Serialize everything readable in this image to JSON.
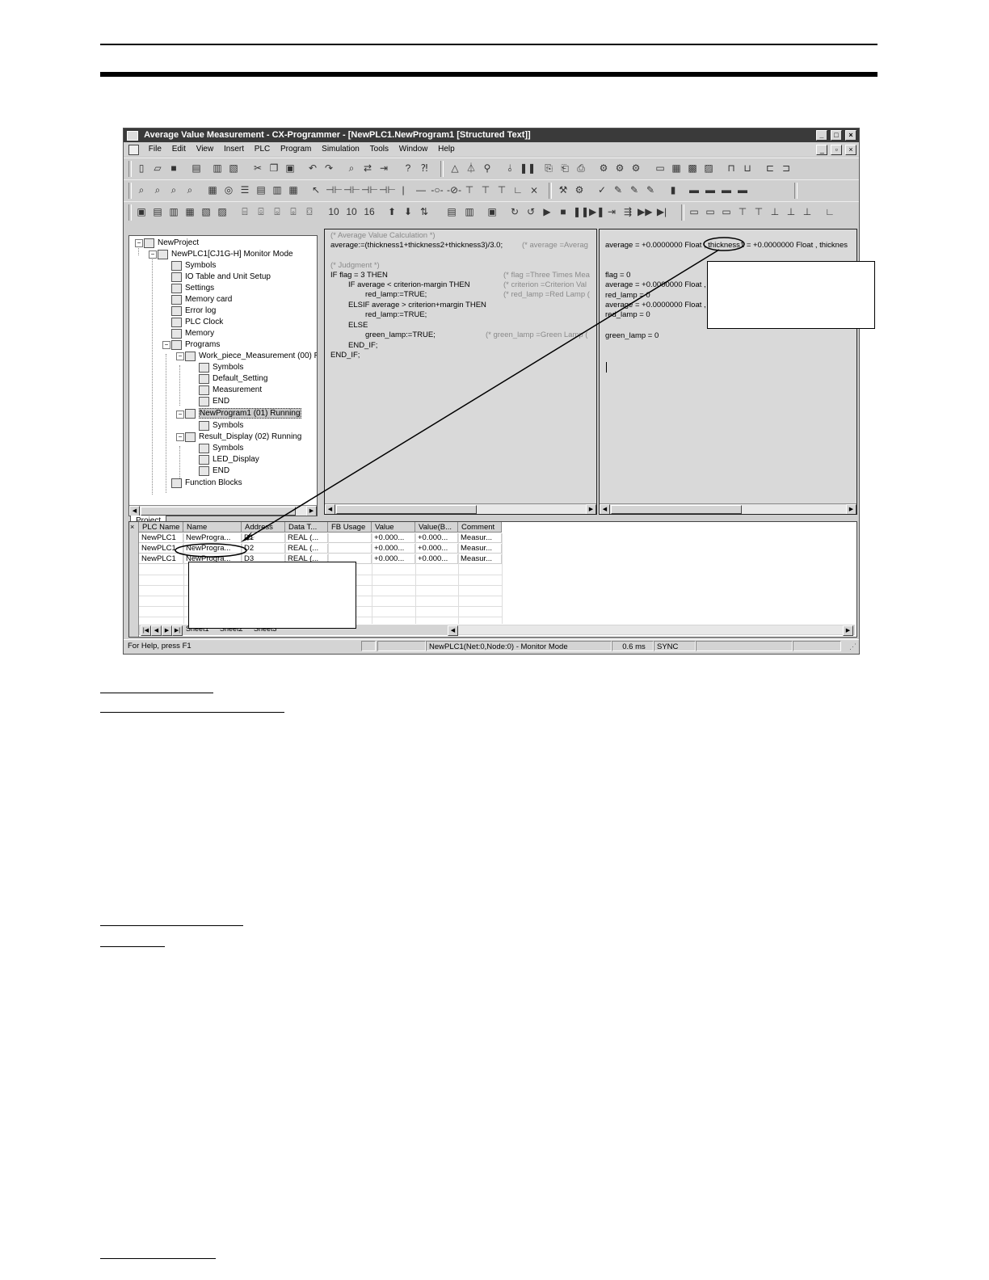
{
  "window": {
    "title": "Average Value Measurement - CX-Programmer - [NewPLC1.NewProgram1 [Structured Text]]",
    "controls": [
      "_",
      "□",
      "×"
    ],
    "doc_controls": [
      "_",
      "▫",
      "×"
    ]
  },
  "menu": [
    "File",
    "Edit",
    "View",
    "Insert",
    "PLC",
    "Program",
    "Simulation",
    "Tools",
    "Window",
    "Help"
  ],
  "tree": {
    "items": [
      {
        "label": "NewProject",
        "icon": "project-icon"
      },
      {
        "label": "NewPLC1[CJ1G-H] Monitor Mode",
        "icon": "plc-icon"
      },
      {
        "label": "Symbols",
        "icon": "symbols-icon"
      },
      {
        "label": "IO Table and Unit Setup",
        "icon": "io-table-icon"
      },
      {
        "label": "Settings",
        "icon": "settings-icon"
      },
      {
        "label": "Memory card",
        "icon": "memory-card-icon"
      },
      {
        "label": "Error log",
        "icon": "error-log-icon"
      },
      {
        "label": "PLC Clock",
        "icon": "clock-icon"
      },
      {
        "label": "Memory",
        "icon": "memory-icon"
      },
      {
        "label": "Programs",
        "icon": "programs-icon"
      },
      {
        "label": "Work_piece_Measurement (00) Ru",
        "icon": "program-icon"
      },
      {
        "label": "Symbols",
        "icon": "symbols-icon"
      },
      {
        "label": "Default_Setting",
        "icon": "section-icon"
      },
      {
        "label": "Measurement",
        "icon": "section-icon"
      },
      {
        "label": "END",
        "icon": "section-icon"
      },
      {
        "label": "NewProgram1 (01) Running",
        "icon": "program-icon"
      },
      {
        "label": "Symbols",
        "icon": "symbols-icon"
      },
      {
        "label": "Result_Display (02) Running",
        "icon": "program-icon"
      },
      {
        "label": "Symbols",
        "icon": "symbols-icon"
      },
      {
        "label": "LED_Display",
        "icon": "section-icon"
      },
      {
        "label": "END",
        "icon": "section-icon"
      },
      {
        "label": "Function Blocks",
        "icon": "function-blocks-icon"
      }
    ],
    "tab": "Project"
  },
  "code": {
    "lines": [
      {
        "text": "(* Average Value Calculation *)",
        "comment": true
      },
      {
        "text": "average:=(thickness1+thickness2+thickness3)/3.0;",
        "comment": false
      },
      {
        "text": "(* Judgment *)",
        "comment": true
      },
      {
        "text": "IF flag = 3 THEN",
        "comment": false
      },
      {
        "text": "IF average < criterion-margin  THEN",
        "comment": false
      },
      {
        "text": "red_lamp:=TRUE;",
        "comment": false
      },
      {
        "text": "ELSIF average > criterion+margin THEN",
        "comment": false
      },
      {
        "text": "red_lamp:=TRUE;",
        "comment": false
      },
      {
        "text": "ELSE",
        "comment": false
      },
      {
        "text": "green_lamp:=TRUE;",
        "comment": false
      },
      {
        "text": "END_IF;",
        "comment": false
      },
      {
        "text": "END_IF;",
        "comment": false
      }
    ],
    "comments": [
      "(* average =Averag",
      "(* flag =Three Times Mea",
      "(* criterion =Criterion Val",
      "(* red_lamp =Red Lamp (",
      "(* green_lamp =Green Lamp ("
    ]
  },
  "monitor": {
    "lines": [
      "average = +0.0000000 Float , thickness1 = +0.0000000 Float , thicknes",
      "flag = 0",
      "average = +0.0000000 Float ,",
      "red_lamp = 0",
      "average = +0.0000000 Float ,",
      "red_lamp = 0",
      "green_lamp = 0"
    ]
  },
  "table": {
    "headers": [
      "PLC Name",
      "Name",
      "Address",
      "Data T...",
      "FB Usage",
      "Value",
      "Value(B...",
      "Comment"
    ],
    "rows": [
      [
        "NewPLC1",
        "NewProgra...",
        "D1",
        "REAL (...",
        "",
        "+0.000...",
        "+0.000...",
        "Measur..."
      ],
      [
        "NewPLC1",
        "NewProgra...",
        "D2",
        "REAL (...",
        "",
        "+0.000...",
        "+0.000...",
        "Measur..."
      ],
      [
        "NewPLC1",
        "NewProgra...",
        "D3",
        "REAL (...",
        "",
        "+0.000...",
        "+0.000...",
        "Measur..."
      ]
    ],
    "sheet_tabs": [
      "Sheet1",
      "Sheet2",
      "Sheet3"
    ]
  },
  "status": {
    "help": "For Help, press F1",
    "connection": "NewPLC1(Net:0,Node:0) - Monitor Mode",
    "cycle": "0.6 ms",
    "sync": "SYNC"
  }
}
